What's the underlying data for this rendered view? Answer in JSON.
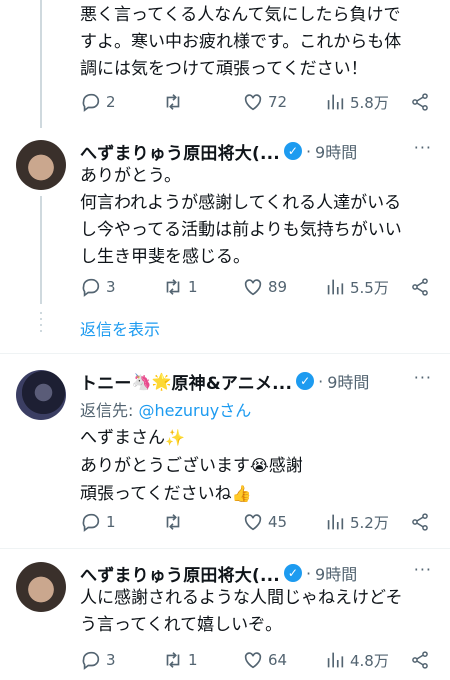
{
  "tweets": [
    {
      "text_lines": [
        "悪く言ってくる人なんて気にしたら負けで",
        "すよ。寒い中お疲れ様です。これからも体",
        "調には気をつけて頑張ってください！"
      ],
      "replies": "2",
      "retweets": "",
      "likes": "72",
      "views": "5.8万"
    },
    {
      "name": "へずまりゅう原田将大(...",
      "time": "9時間",
      "text_lines": [
        "ありがとう。",
        "何言われようが感謝してくれる人達がいる",
        "し今やってる活動は前よりも気持ちがいい",
        "し生き甲斐を感じる。"
      ],
      "replies": "3",
      "retweets": "1",
      "likes": "89",
      "views": "5.5万"
    },
    {
      "name": "トニー",
      "name_rest": "原神&アニメ...",
      "time": "9時間",
      "reply_prefix": "返信先: ",
      "reply_handle": "@hezuruyさん",
      "text_lines": [
        "へずまさん",
        "ありがとうございます",
        "感謝",
        "頑張ってくださいね"
      ],
      "replies": "1",
      "retweets": "",
      "likes": "45",
      "views": "5.2万"
    },
    {
      "name": "へずまりゅう原田将大(...",
      "time": "9時間",
      "text_lines": [
        "人に感謝されるような人間じゃねえけどそ",
        "う言ってくれて嬉しいぞ。"
      ],
      "replies": "3",
      "retweets": "1",
      "likes": "64",
      "views": "4.8万"
    }
  ],
  "show_replies": "返信を表示",
  "time_sep": "·",
  "more_label": "···",
  "verified_mark": "✓",
  "colors": {
    "accent": "#1d9bf0",
    "muted": "#536471",
    "text": "#0f1419"
  },
  "icons": [
    "reply-icon",
    "retweet-icon",
    "like-icon",
    "views-icon",
    "share-icon",
    "verified-badge-icon",
    "more-icon",
    "unicorn-emoji",
    "star-emoji",
    "sparkles-emoji",
    "crying-emoji",
    "thumbs-up-emoji"
  ]
}
